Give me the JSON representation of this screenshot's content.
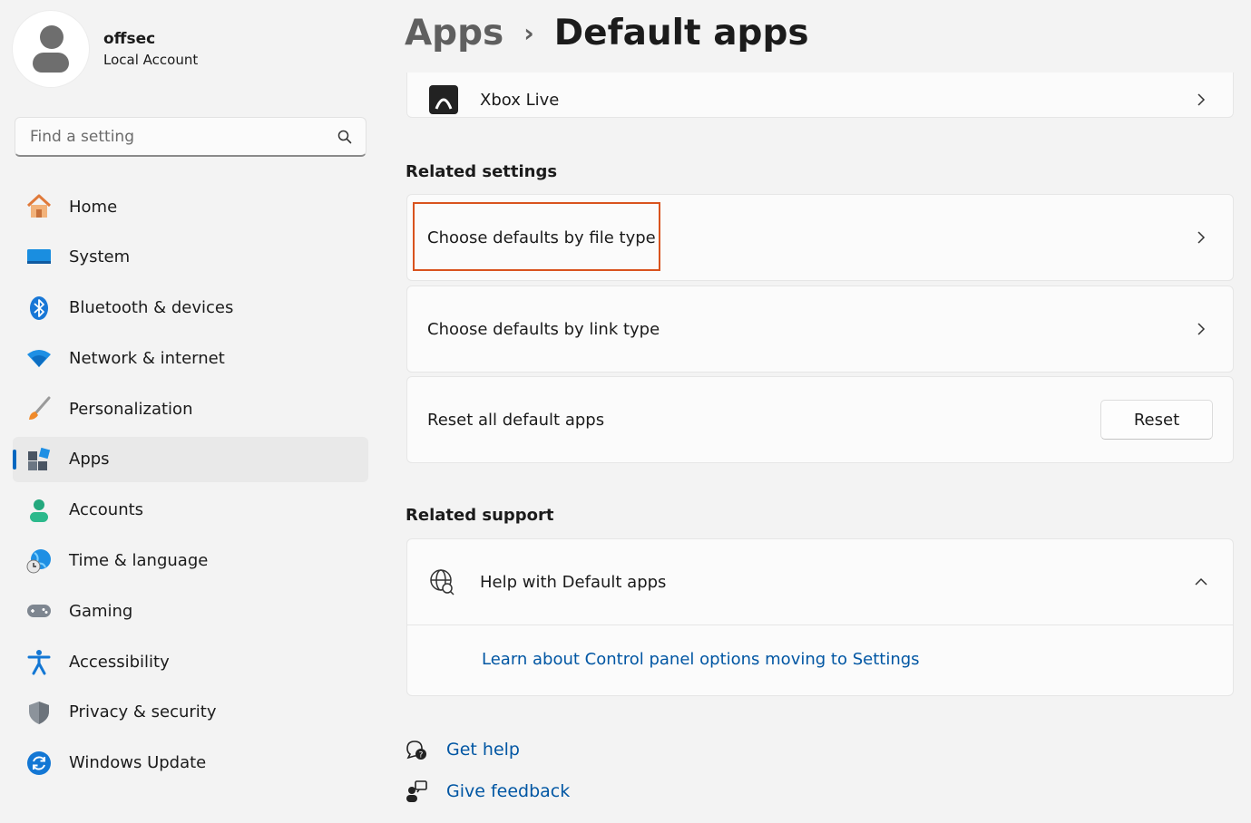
{
  "profile": {
    "name": "offsec",
    "account_type": "Local Account"
  },
  "search": {
    "placeholder": "Find a setting"
  },
  "sidebar": {
    "items": [
      {
        "label": "Home",
        "icon": "home-icon"
      },
      {
        "label": "System",
        "icon": "system-icon"
      },
      {
        "label": "Bluetooth & devices",
        "icon": "bluetooth-icon"
      },
      {
        "label": "Network & internet",
        "icon": "wifi-icon"
      },
      {
        "label": "Personalization",
        "icon": "brush-icon"
      },
      {
        "label": "Apps",
        "icon": "apps-icon",
        "selected": true
      },
      {
        "label": "Accounts",
        "icon": "accounts-icon"
      },
      {
        "label": "Time & language",
        "icon": "globe-clock-icon"
      },
      {
        "label": "Gaming",
        "icon": "gamepad-icon"
      },
      {
        "label": "Accessibility",
        "icon": "accessibility-icon"
      },
      {
        "label": "Privacy & security",
        "icon": "shield-icon"
      },
      {
        "label": "Windows Update",
        "icon": "update-icon"
      }
    ]
  },
  "header": {
    "parent": "Apps",
    "separator": "›",
    "current": "Default apps"
  },
  "main": {
    "partial_item": {
      "label": "Xbox Live",
      "icon": "xbox-icon"
    },
    "related_settings": {
      "title": "Related settings",
      "file_type": "Choose defaults by file type",
      "link_type": "Choose defaults by link type",
      "reset_label": "Reset all default apps",
      "reset_button": "Reset"
    },
    "related_support": {
      "title": "Related support",
      "help_label": "Help with Default apps",
      "learn_link": "Learn about Control panel options moving to Settings"
    },
    "footer": {
      "get_help": "Get help",
      "give_feedback": "Give feedback"
    }
  },
  "colors": {
    "accent": "#0067c0",
    "link": "#0056a3",
    "highlight_border": "#d9531e"
  }
}
